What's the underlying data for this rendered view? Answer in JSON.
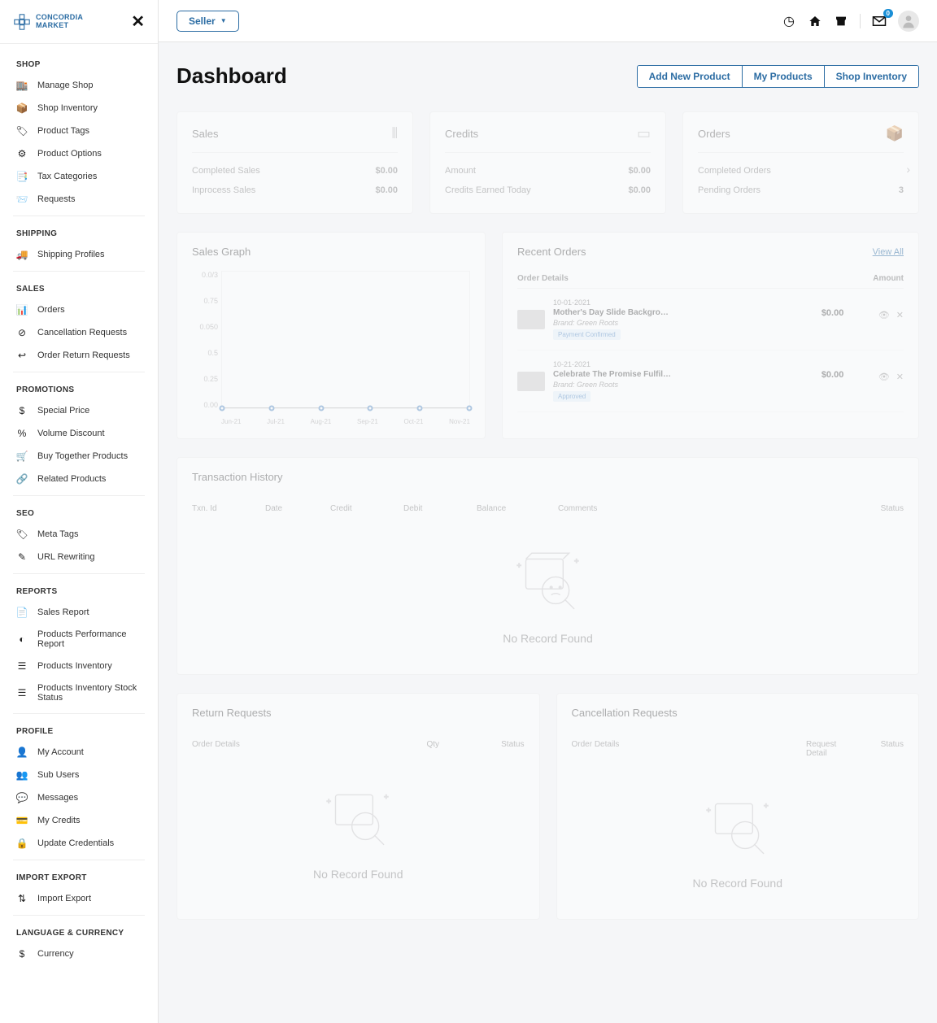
{
  "brand": {
    "name": "CONCORDIA",
    "sub": "MARKET"
  },
  "topbar": {
    "seller_label": "Seller",
    "notif_count": "0"
  },
  "sidebar": {
    "sections": [
      {
        "title": "SHOP",
        "items": [
          {
            "icon": "🏬",
            "label": "Manage Shop"
          },
          {
            "icon": "📦",
            "label": "Shop Inventory"
          },
          {
            "icon": "🏷",
            "label": "Product Tags"
          },
          {
            "icon": "⚙",
            "label": "Product Options"
          },
          {
            "icon": "📑",
            "label": "Tax Categories"
          },
          {
            "icon": "📨",
            "label": "Requests"
          }
        ]
      },
      {
        "title": "SHIPPING",
        "items": [
          {
            "icon": "🚚",
            "label": "Shipping Profiles"
          }
        ]
      },
      {
        "title": "SALES",
        "items": [
          {
            "icon": "📊",
            "label": "Orders"
          },
          {
            "icon": "⊘",
            "label": "Cancellation Requests"
          },
          {
            "icon": "↩",
            "label": "Order Return Requests"
          }
        ]
      },
      {
        "title": "PROMOTIONS",
        "items": [
          {
            "icon": "$",
            "label": "Special Price"
          },
          {
            "icon": "%",
            "label": "Volume Discount"
          },
          {
            "icon": "🛒",
            "label": "Buy Together Products"
          },
          {
            "icon": "🔗",
            "label": "Related Products"
          }
        ]
      },
      {
        "title": "SEO",
        "items": [
          {
            "icon": "🏷",
            "label": "Meta Tags"
          },
          {
            "icon": "✎",
            "label": "URL Rewriting"
          }
        ]
      },
      {
        "title": "REPORTS",
        "items": [
          {
            "icon": "📄",
            "label": "Sales Report"
          },
          {
            "icon": "◐",
            "label": "Products Performance Report"
          },
          {
            "icon": "☰",
            "label": "Products Inventory"
          },
          {
            "icon": "☰",
            "label": "Products Inventory Stock Status"
          }
        ]
      },
      {
        "title": "PROFILE",
        "items": [
          {
            "icon": "👤",
            "label": "My Account"
          },
          {
            "icon": "👥",
            "label": "Sub Users"
          },
          {
            "icon": "💬",
            "label": "Messages"
          },
          {
            "icon": "💳",
            "label": "My Credits"
          },
          {
            "icon": "🔒",
            "label": "Update Credentials"
          }
        ]
      },
      {
        "title": "IMPORT EXPORT",
        "items": [
          {
            "icon": "⇅",
            "label": "Import Export"
          }
        ]
      },
      {
        "title": "LANGUAGE & CURRENCY",
        "items": [
          {
            "icon": "$",
            "label": "Currency"
          }
        ]
      }
    ]
  },
  "page": {
    "title": "Dashboard",
    "actions": [
      "Add New Product",
      "My Products",
      "Shop Inventory"
    ]
  },
  "stats": {
    "sales": {
      "title": "Sales",
      "rows": [
        [
          "Completed Sales",
          "$0.00"
        ],
        [
          "Inprocess Sales",
          "$0.00"
        ]
      ]
    },
    "credits": {
      "title": "Credits",
      "rows": [
        [
          "Amount",
          "$0.00"
        ],
        [
          "Credits Earned Today",
          "$0.00"
        ]
      ]
    },
    "orders": {
      "title": "Orders",
      "rows": [
        [
          "Completed Orders",
          ""
        ],
        [
          "Pending Orders",
          "3"
        ]
      ]
    }
  },
  "graph": {
    "title": "Sales Graph"
  },
  "recent_orders": {
    "title": "Recent Orders",
    "view_all": "View All",
    "cols": [
      "Order Details",
      "Amount"
    ],
    "rows": [
      {
        "date": "10-01-2021",
        "name": "Mother's Day Slide Backgro…",
        "brand": "Brand: Green Roots",
        "status": "Payment Confirmed",
        "amount": "$0.00"
      },
      {
        "date": "10-21-2021",
        "name": "Celebrate The Promise Fulfil…",
        "brand": "Brand: Green Roots",
        "status": "Approved",
        "amount": "$0.00"
      }
    ]
  },
  "tx": {
    "title": "Transaction History",
    "cols": [
      "Txn. Id",
      "Date",
      "Credit",
      "Debit",
      "Balance",
      "Comments",
      "Status"
    ],
    "empty": "No Record Found"
  },
  "returns": {
    "title": "Return Requests",
    "cols": [
      "Order Details",
      "Qty",
      "Status"
    ],
    "empty": "No Record Found"
  },
  "cancels": {
    "title": "Cancellation Requests",
    "cols": [
      "Order Details",
      "Request Detail",
      "Status"
    ],
    "empty": "No Record Found"
  },
  "chart_data": {
    "type": "line",
    "title": "Sales Graph",
    "categories": [
      "Jun-21",
      "Jul-21",
      "Aug-21",
      "Sep-21",
      "Oct-21",
      "Nov-21"
    ],
    "values": [
      0,
      0,
      0,
      0,
      0,
      0
    ],
    "y_ticks": [
      "0.0/3",
      "0.75",
      "0.050",
      "0.5",
      "0.25",
      "0.00"
    ],
    "ylabel": "",
    "xlabel": "",
    "ylim": [
      0,
      1
    ]
  }
}
